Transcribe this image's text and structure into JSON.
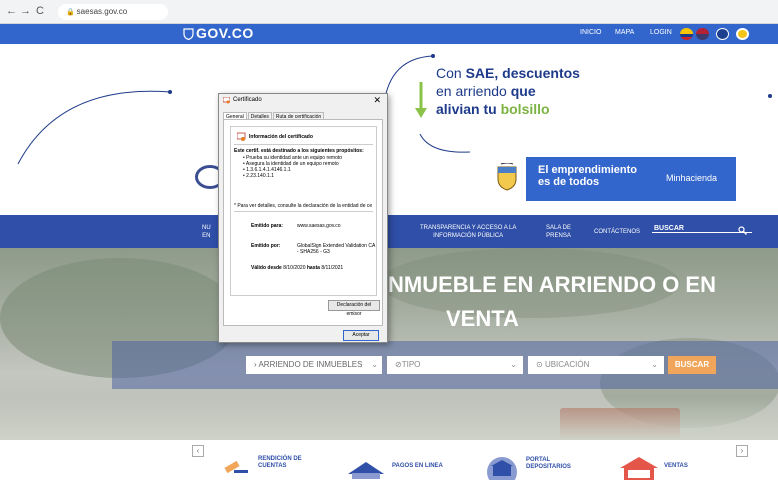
{
  "browser": {
    "back": "←",
    "forward": "→",
    "reload": "C",
    "url": "saesas.gov.co"
  },
  "govbar": {
    "logo": "GOV.CO",
    "nav": [
      "INICIO",
      "MAPA",
      "LOGIN"
    ]
  },
  "promo": {
    "line1_a": "Con ",
    "line1_b": "SAE, descuentos",
    "line2_a": "en arriendo ",
    "line2_b": "que",
    "line3_a": "alivian tu ",
    "line3_b": "bolsillo"
  },
  "emprendimiento": {
    "line1": "El emprendimiento",
    "line2": "es de todos",
    "ministry": "Minhacienda"
  },
  "mainnav": {
    "items": [
      {
        "label": "NU\nEN"
      },
      {
        "label": "TRANSPARENCIA Y ACCESO A LA\nINFORMACIÓN PÚBLICA"
      },
      {
        "label": "SALA DE\nPRENSA"
      },
      {
        "label": "CONTÁCTENOS"
      }
    ],
    "search_label": "BUSCAR"
  },
  "banner": {
    "title_line1": "NMUEBLE EN ARRIENDO O EN",
    "title_line2": "VENTA"
  },
  "filters": {
    "type_select": "ARRIENDO DE INMUEBLES",
    "tipo_select": "TIPO",
    "ubicacion_select": "UBICACIÓN",
    "buscar_button": "BUSCAR"
  },
  "services": [
    {
      "label": "RENDICIÓN DE\nCUENTAS"
    },
    {
      "label": "PAGOS EN LINEA"
    },
    {
      "label": "PORTAL\nDEPOSITARIOS"
    },
    {
      "label": "VENTAS"
    }
  ],
  "dialog": {
    "title": "Certificado",
    "close": "✕",
    "tabs": [
      "General",
      "Detalles",
      "Ruta de certificación"
    ],
    "heading": "Información del certificado",
    "purpose_heading": "Este certif. está destinado a los siguientes propósitos:",
    "purposes": [
      "• Prueba su identidad ante un equipo remoto",
      "• Asegura la identidad de un equipo remoto",
      "• 1.3.6.1.4.1.4146.1.1",
      "• 2.23.140.1.1"
    ],
    "note": "* Para ver detalles, consulte la declaración de la entidad de ce",
    "issued_to_label": "Emitido para:",
    "issued_to_value": "www.saesas.gov.co",
    "issued_by_label": "Emitido por:",
    "issued_by_value": "GlobalSign Extended Validation CA - SHA256 - G3",
    "valid_from_label": "Válido desde",
    "valid_from_value": "8/10/2020",
    "valid_to_label": "hasta",
    "valid_to_value": "8/11/2021",
    "declaration_button": "Declaración del emisor",
    "accept_button": "Aceptar"
  }
}
